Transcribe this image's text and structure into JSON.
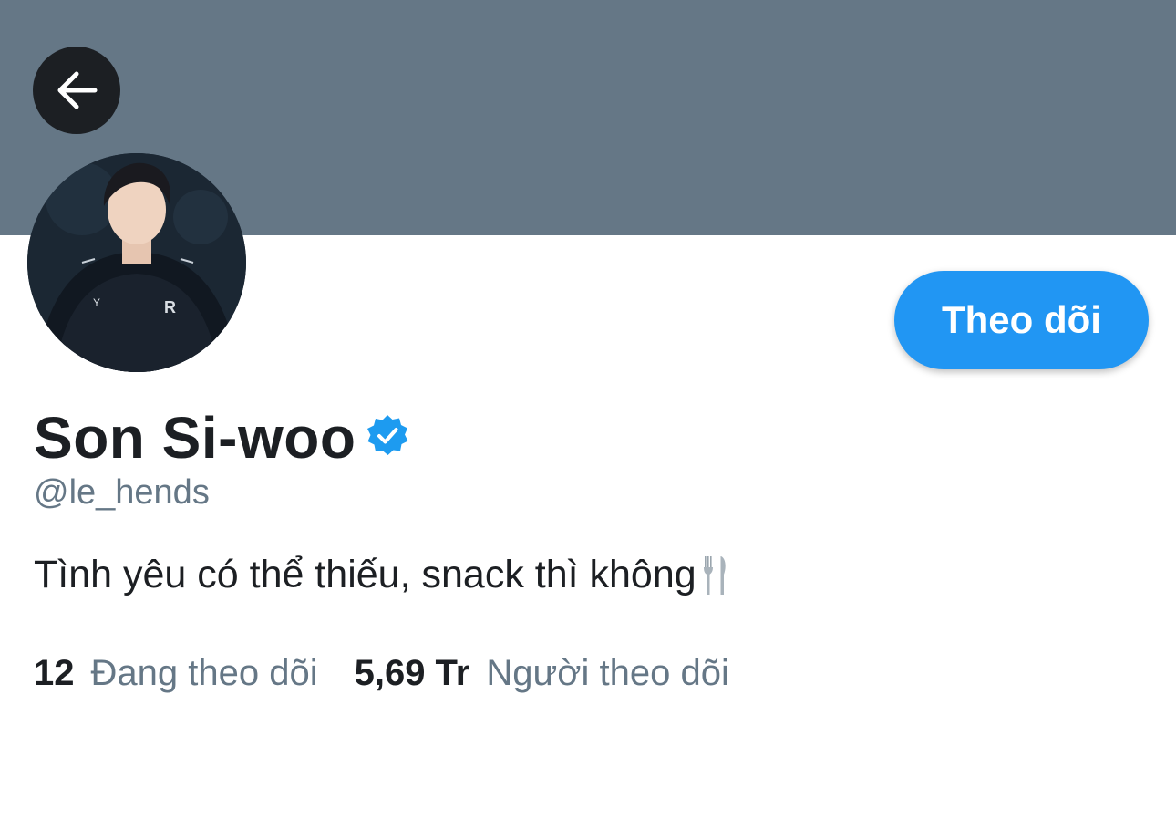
{
  "profile": {
    "display_name": "Son Si-woo",
    "handle": "@le_hends",
    "bio": "Tình yêu có thể thiếu, snack thì không",
    "bio_icon": "fork-and-knife-icon",
    "verified": true
  },
  "header": {
    "back_icon": "arrow-left-icon",
    "banner_color": "#657786"
  },
  "actions": {
    "follow_label": "Theo dõi",
    "accent_color": "#2196f3"
  },
  "stats": {
    "following": {
      "count": "12",
      "label": "Đang theo dõi"
    },
    "followers": {
      "count": "5,69 Tr",
      "label": "Người theo dõi"
    }
  }
}
